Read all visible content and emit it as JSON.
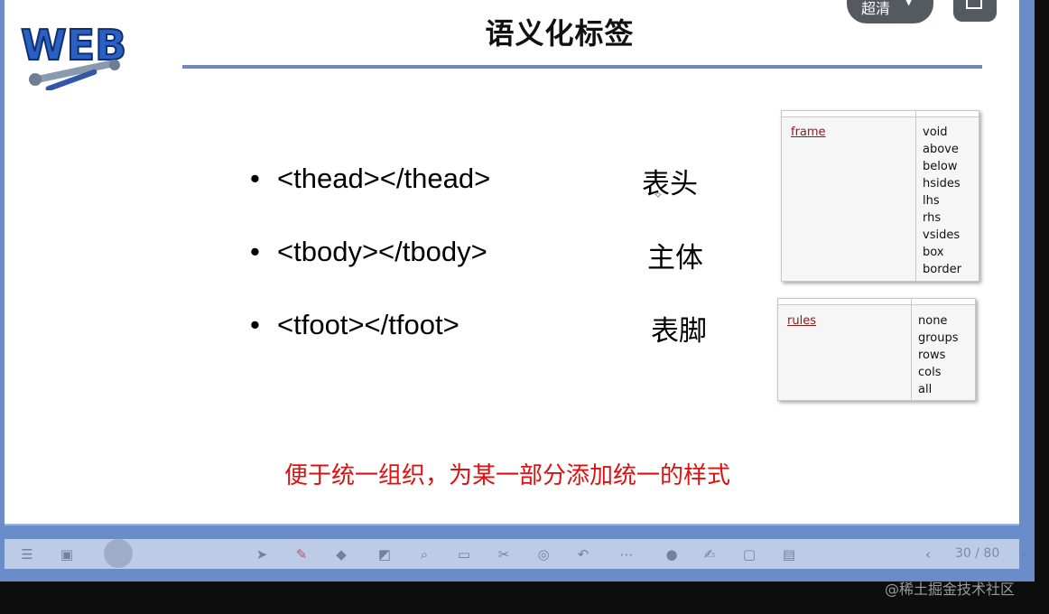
{
  "slide": {
    "title": "语义化标签",
    "bullets": [
      {
        "tag": "<thead></thead>",
        "label": "表头"
      },
      {
        "tag": "<tbody></tbody>",
        "label": "主体"
      },
      {
        "tag": "<tfoot></tfoot>",
        "label": "表脚"
      }
    ],
    "note": "便于统一组织，为某一部分添加统一的样式",
    "frame_table": {
      "attr": "frame",
      "values": [
        "void",
        "above",
        "below",
        "hsides",
        "lhs",
        "rhs",
        "vsides",
        "box",
        "border"
      ]
    },
    "rules_table": {
      "attr": "rules",
      "values": [
        "none",
        "groups",
        "rows",
        "cols",
        "all"
      ]
    }
  },
  "logo": {
    "text": "WEB",
    "color": "#2b5fc1"
  },
  "player": {
    "quality_label": "超清",
    "page_counter": "30 / 80",
    "pen_color": "#e03030"
  },
  "watermark": "@稀土掘金技术社区",
  "colors": {
    "frame_blue": "#6a8cc8",
    "title_rule": "#6f87bd",
    "note_red": "#e01010",
    "attr_red": "#8b1a1a"
  },
  "toolbar_icons": [
    "menu-icon",
    "slides-icon",
    "avatar",
    "pointer-icon",
    "pen-icon",
    "eraser-icon",
    "shape-icon",
    "search-icon",
    "board-icon",
    "cut-icon",
    "target-icon",
    "undo-icon",
    "more-icon",
    "mic-icon",
    "note-icon",
    "screen-icon",
    "stack-icon",
    "prev-icon",
    "next-icon"
  ]
}
